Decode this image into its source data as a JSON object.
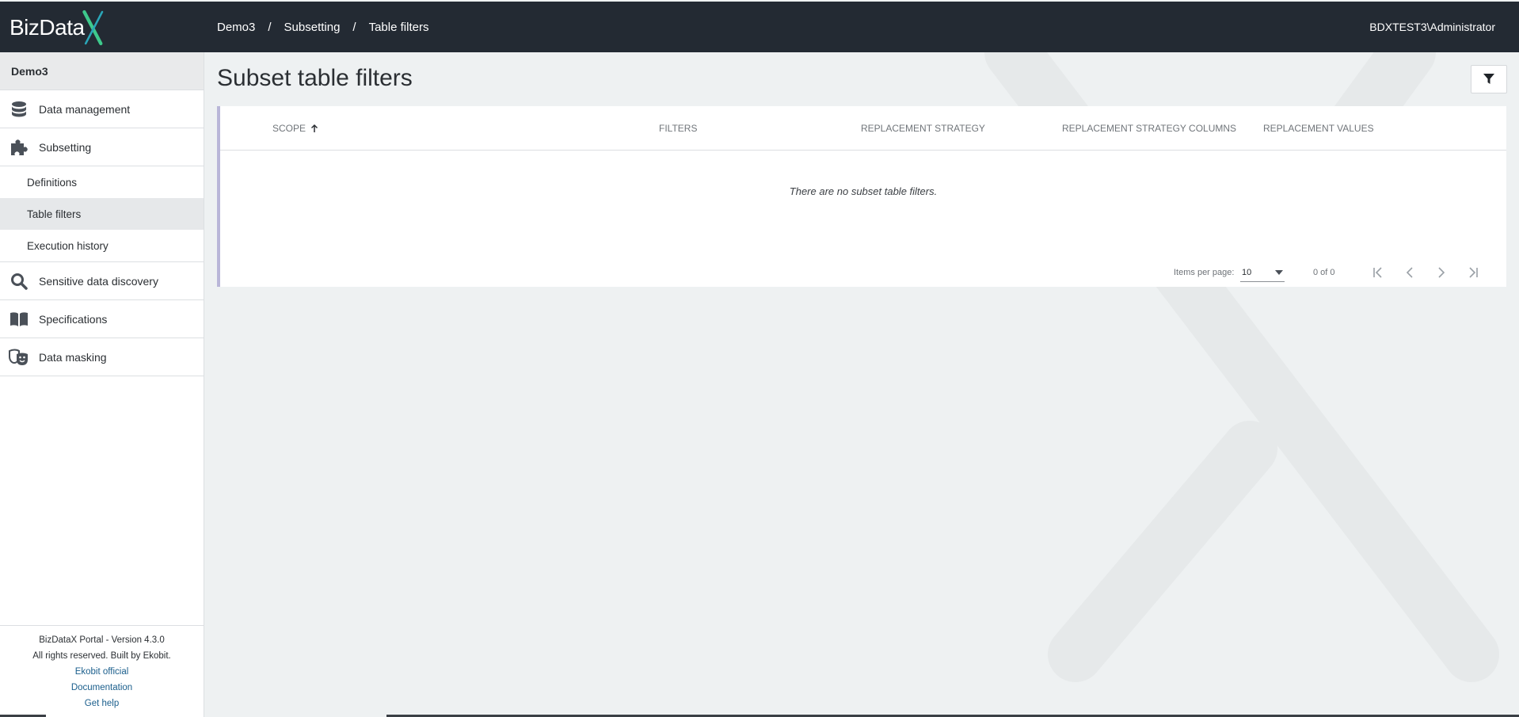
{
  "header": {
    "logo_text": "BizData",
    "breadcrumb": [
      "Demo3",
      "Subsetting",
      "Table filters"
    ],
    "separator": "/",
    "user": "BDXTEST3\\Administrator"
  },
  "sidebar": {
    "project": "Demo3",
    "items": [
      {
        "label": "Data management",
        "icon": "database-icon"
      },
      {
        "label": "Subsetting",
        "icon": "puzzle-icon"
      },
      {
        "label": "Sensitive data discovery",
        "icon": "search-icon"
      },
      {
        "label": "Specifications",
        "icon": "book-icon"
      },
      {
        "label": "Data masking",
        "icon": "masks-icon"
      }
    ],
    "sub_items": [
      {
        "label": "Definitions"
      },
      {
        "label": "Table filters",
        "active": true
      },
      {
        "label": "Execution history"
      }
    ],
    "footer": {
      "version": "BizDataX Portal - Version 4.3.0",
      "rights": "All rights reserved. Built by Ekobit.",
      "links": [
        "Ekobit official",
        "Documentation",
        "Get help"
      ]
    }
  },
  "main": {
    "title": "Subset table filters",
    "table": {
      "columns": [
        "Scope",
        "Filters",
        "Replacement strategy",
        "Replacement strategy columns",
        "Replacement values"
      ],
      "sort_column": "Scope",
      "sort_direction": "ascending",
      "empty_message": "There are no subset table filters."
    },
    "paginator": {
      "items_per_page_label": "Items per page:",
      "items_per_page_value": "10",
      "range_label": "0 of 0"
    }
  },
  "colors": {
    "header_bg": "#232a33",
    "accent_green": "#3ec98c",
    "link": "#1a5e8c"
  }
}
